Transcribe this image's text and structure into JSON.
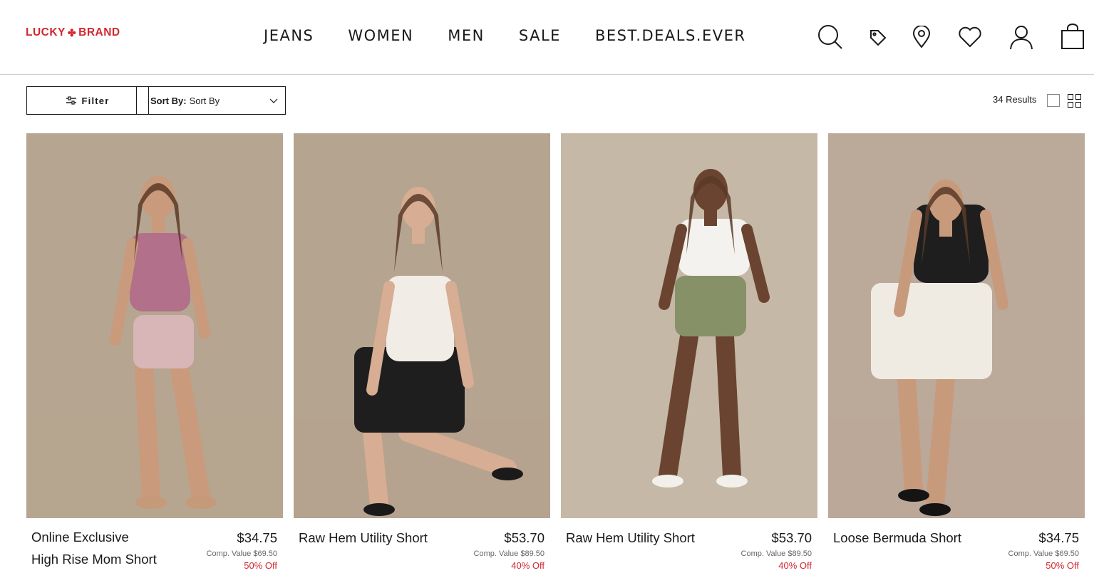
{
  "brand": {
    "left": "LUCKY",
    "right": "BRAND",
    "color": "#d22630"
  },
  "nav": [
    "JEANS",
    "WOMEN",
    "MEN",
    "SALE",
    "BEST.DEALS.EVER"
  ],
  "header_icons": [
    "search-icon",
    "tag-icon",
    "location-icon",
    "heart-icon",
    "account-icon",
    "bag-icon"
  ],
  "toolbar": {
    "filter_label": "Filter",
    "sort_label": "Sort By:",
    "sort_value": "Sort By",
    "results": "34 Results"
  },
  "products": [
    {
      "badge": "Online Exclusive",
      "name": "High Rise Mom Short",
      "price": "$34.75",
      "comp": "Comp. Value $69.50",
      "off": "50% Off",
      "bg": "#b6a590",
      "top": "#b2708a",
      "bottom": "#d8b5b6",
      "skin": "#c99a7c",
      "shoes": "#c49a78"
    },
    {
      "badge": "",
      "name": "Raw Hem Utility Short",
      "price": "$53.70",
      "comp": "Comp. Value $89.50",
      "off": "40% Off",
      "bg": "#b5a48f",
      "top": "#f1ede6",
      "bottom": "#1e1e1e",
      "skin": "#d7ad93",
      "shoes": "#1a1a1a"
    },
    {
      "badge": "",
      "name": "Raw Hem Utility Short",
      "price": "$53.70",
      "comp": "Comp. Value $89.50",
      "off": "40% Off",
      "bg": "#c5b8a6",
      "top": "#f4f2ee",
      "bottom": "#879168",
      "skin": "#6a4430",
      "shoes": "#f2f0ea"
    },
    {
      "badge": "",
      "name": "Loose Bermuda Short",
      "price": "$34.75",
      "comp": "Comp. Value $69.50",
      "off": "50% Off",
      "bg": "#bba99a",
      "top": "#1e1e1e",
      "bottom": "#efebe3",
      "skin": "#c89a7c",
      "shoes": "#141414"
    }
  ]
}
